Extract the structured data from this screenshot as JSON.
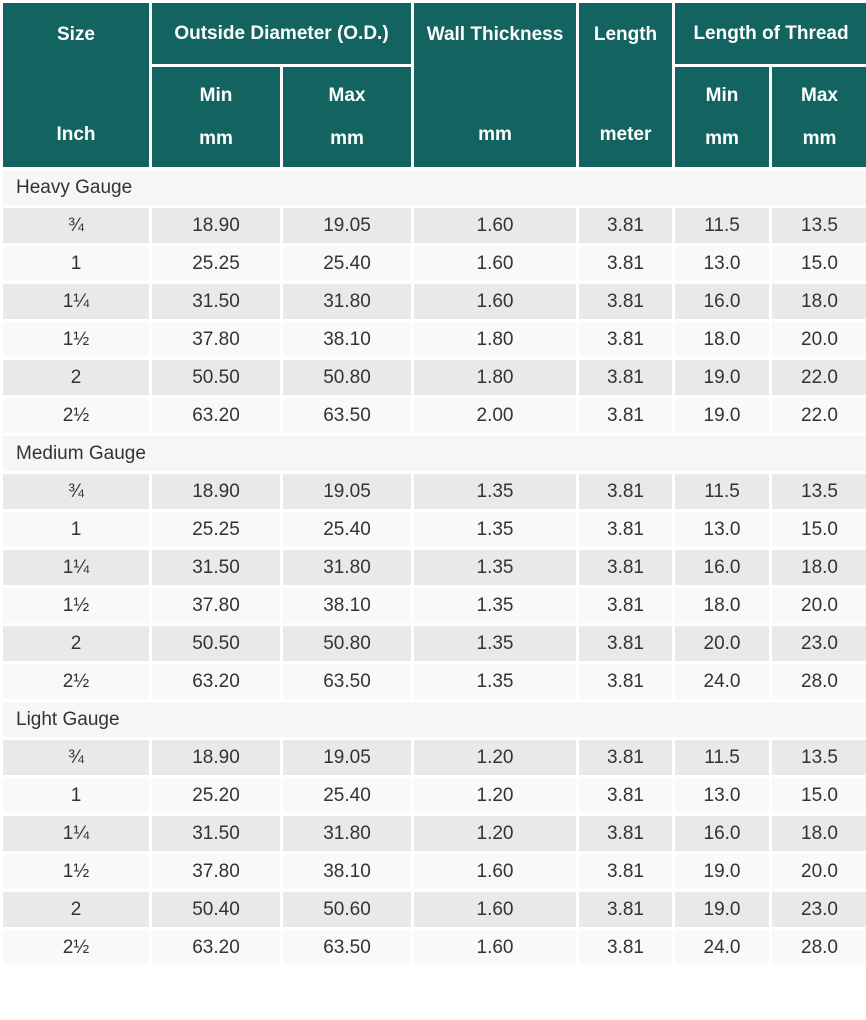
{
  "headers": {
    "size": "Size",
    "size_unit": "Inch",
    "od": "Outside Diameter (O.D.)",
    "od_min": "Min",
    "od_min_unit": "mm",
    "od_max": "Max",
    "od_max_unit": "mm",
    "wall": "Wall Thickness",
    "wall_unit": "mm",
    "length": "Length",
    "length_unit": "meter",
    "thread": "Length of Thread",
    "thread_min": "Min",
    "thread_min_unit": "mm",
    "thread_max": "Max",
    "thread_max_unit": "mm"
  },
  "groups": [
    {
      "label": "Heavy Gauge",
      "rows": [
        [
          "¾",
          "18.90",
          "19.05",
          "1.60",
          "3.81",
          "11.5",
          "13.5"
        ],
        [
          "1",
          "25.25",
          "25.40",
          "1.60",
          "3.81",
          "13.0",
          "15.0"
        ],
        [
          "1¼",
          "31.50",
          "31.80",
          "1.60",
          "3.81",
          "16.0",
          "18.0"
        ],
        [
          "1½",
          "37.80",
          "38.10",
          "1.80",
          "3.81",
          "18.0",
          "20.0"
        ],
        [
          "2",
          "50.50",
          "50.80",
          "1.80",
          "3.81",
          "19.0",
          "22.0"
        ],
        [
          "2½",
          "63.20",
          "63.50",
          "2.00",
          "3.81",
          "19.0",
          "22.0"
        ]
      ]
    },
    {
      "label": "Medium Gauge",
      "rows": [
        [
          "¾",
          "18.90",
          "19.05",
          "1.35",
          "3.81",
          "11.5",
          "13.5"
        ],
        [
          "1",
          "25.25",
          "25.40",
          "1.35",
          "3.81",
          "13.0",
          "15.0"
        ],
        [
          "1¼",
          "31.50",
          "31.80",
          "1.35",
          "3.81",
          "16.0",
          "18.0"
        ],
        [
          "1½",
          "37.80",
          "38.10",
          "1.35",
          "3.81",
          "18.0",
          "20.0"
        ],
        [
          "2",
          "50.50",
          "50.80",
          "1.35",
          "3.81",
          "20.0",
          "23.0"
        ],
        [
          "2½",
          "63.20",
          "63.50",
          "1.35",
          "3.81",
          "24.0",
          "28.0"
        ]
      ]
    },
    {
      "label": "Light Gauge",
      "rows": [
        [
          "¾",
          "18.90",
          "19.05",
          "1.20",
          "3.81",
          "11.5",
          "13.5"
        ],
        [
          "1",
          "25.20",
          "25.40",
          "1.20",
          "3.81",
          "13.0",
          "15.0"
        ],
        [
          "1¼",
          "31.50",
          "31.80",
          "1.20",
          "3.81",
          "16.0",
          "18.0"
        ],
        [
          "1½",
          "37.80",
          "38.10",
          "1.60",
          "3.81",
          "19.0",
          "20.0"
        ],
        [
          "2",
          "50.40",
          "50.60",
          "1.60",
          "3.81",
          "19.0",
          "23.0"
        ],
        [
          "2½",
          "63.20",
          "63.50",
          "1.60",
          "3.81",
          "24.0",
          "28.0"
        ]
      ]
    }
  ]
}
